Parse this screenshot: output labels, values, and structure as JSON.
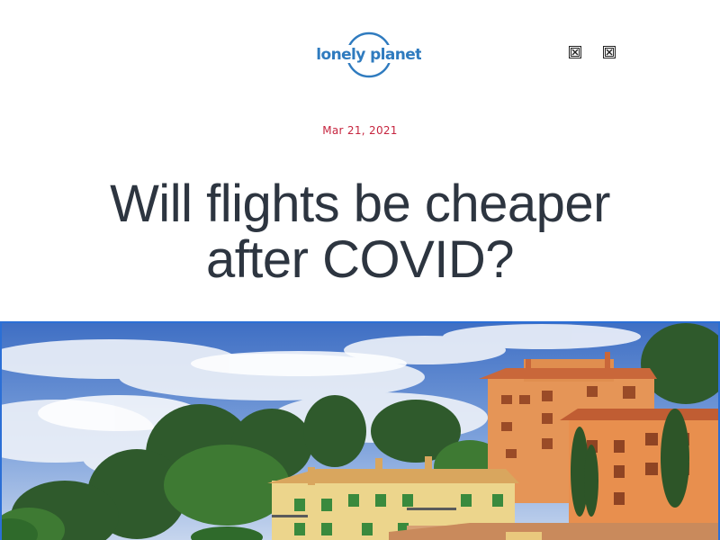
{
  "header": {
    "logo_text": "lonely planet",
    "icons": [
      "broken-image-icon",
      "broken-image-icon"
    ]
  },
  "article": {
    "date": "Mar 21, 2021",
    "title": "Will flights be cheaper after COVID?"
  },
  "hero": {
    "scene": "buildings-on-hillside-photo"
  },
  "colors": {
    "brand": "#2f7bbf",
    "date": "#c6253f",
    "title": "#2d3540",
    "focus_outline": "#2b6fd6"
  }
}
